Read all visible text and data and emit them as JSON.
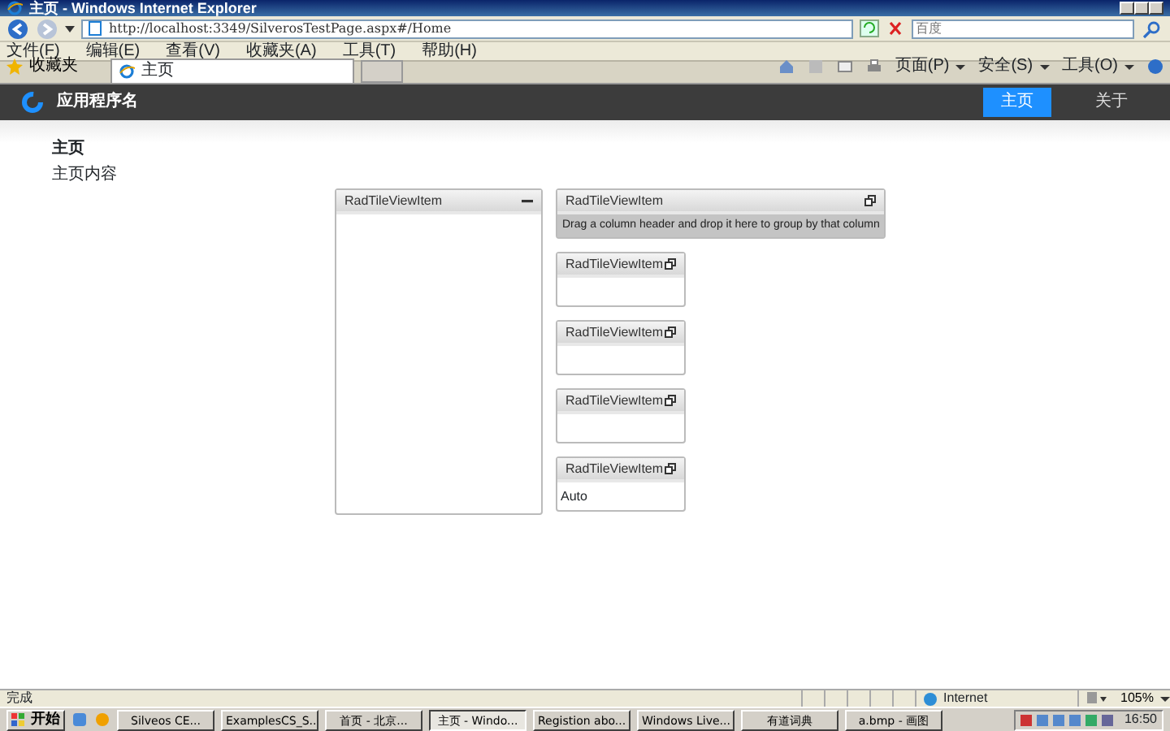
{
  "window": {
    "title": "主页 - Windows Internet Explorer"
  },
  "address_bar": {
    "url": "http://localhost:3349/SilverosTestPage.aspx#/Home"
  },
  "search": {
    "placeholder": "百度"
  },
  "menu": [
    "文件(F)",
    "编辑(E)",
    "查看(V)",
    "收藏夹(A)",
    "工具(T)",
    "帮助(H)"
  ],
  "favorites": "收藏夹",
  "tabs": [
    {
      "label": "主页",
      "selected": true
    }
  ],
  "command_bar": [
    "页面(P)",
    "安全(S)",
    "工具(O)"
  ],
  "app": {
    "name": "应用程序名",
    "nav": [
      {
        "label": "主页",
        "selected": true
      },
      {
        "label": "关于",
        "selected": false
      }
    ],
    "heading": "主页",
    "content": "主页内容",
    "tiles": [
      {
        "title": "RadTileViewItem",
        "kind": "maximized"
      },
      {
        "title": "RadTileViewItem",
        "kind": "minimized",
        "group_panel": "Drag a column header and drop it here to group by that column"
      },
      {
        "title": "RadTileViewItem",
        "kind": "minimized"
      },
      {
        "title": "RadTileViewItem",
        "kind": "minimized"
      },
      {
        "title": "RadTileViewItem",
        "kind": "minimized"
      },
      {
        "title": "RadTileViewItem",
        "kind": "minimized",
        "content": "Auto"
      }
    ]
  },
  "status_bar": {
    "text": "完成",
    "zone": "Internet",
    "zoom": "105%"
  },
  "taskbar": {
    "start": "开始",
    "tasks": [
      {
        "label": "Silveos CE...",
        "selected": false
      },
      {
        "label": "ExamplesCS_S...",
        "selected": false
      },
      {
        "label": "首页 - 北京...",
        "selected": false
      },
      {
        "label": "主页 - Windo...",
        "selected": true
      },
      {
        "label": "Registion abo...",
        "selected": false
      },
      {
        "label": "Windows Live...",
        "selected": false
      },
      {
        "label": "有道词典",
        "selected": false
      },
      {
        "label": "a.bmp - 画图",
        "selected": false
      }
    ],
    "clock": "16:50"
  }
}
